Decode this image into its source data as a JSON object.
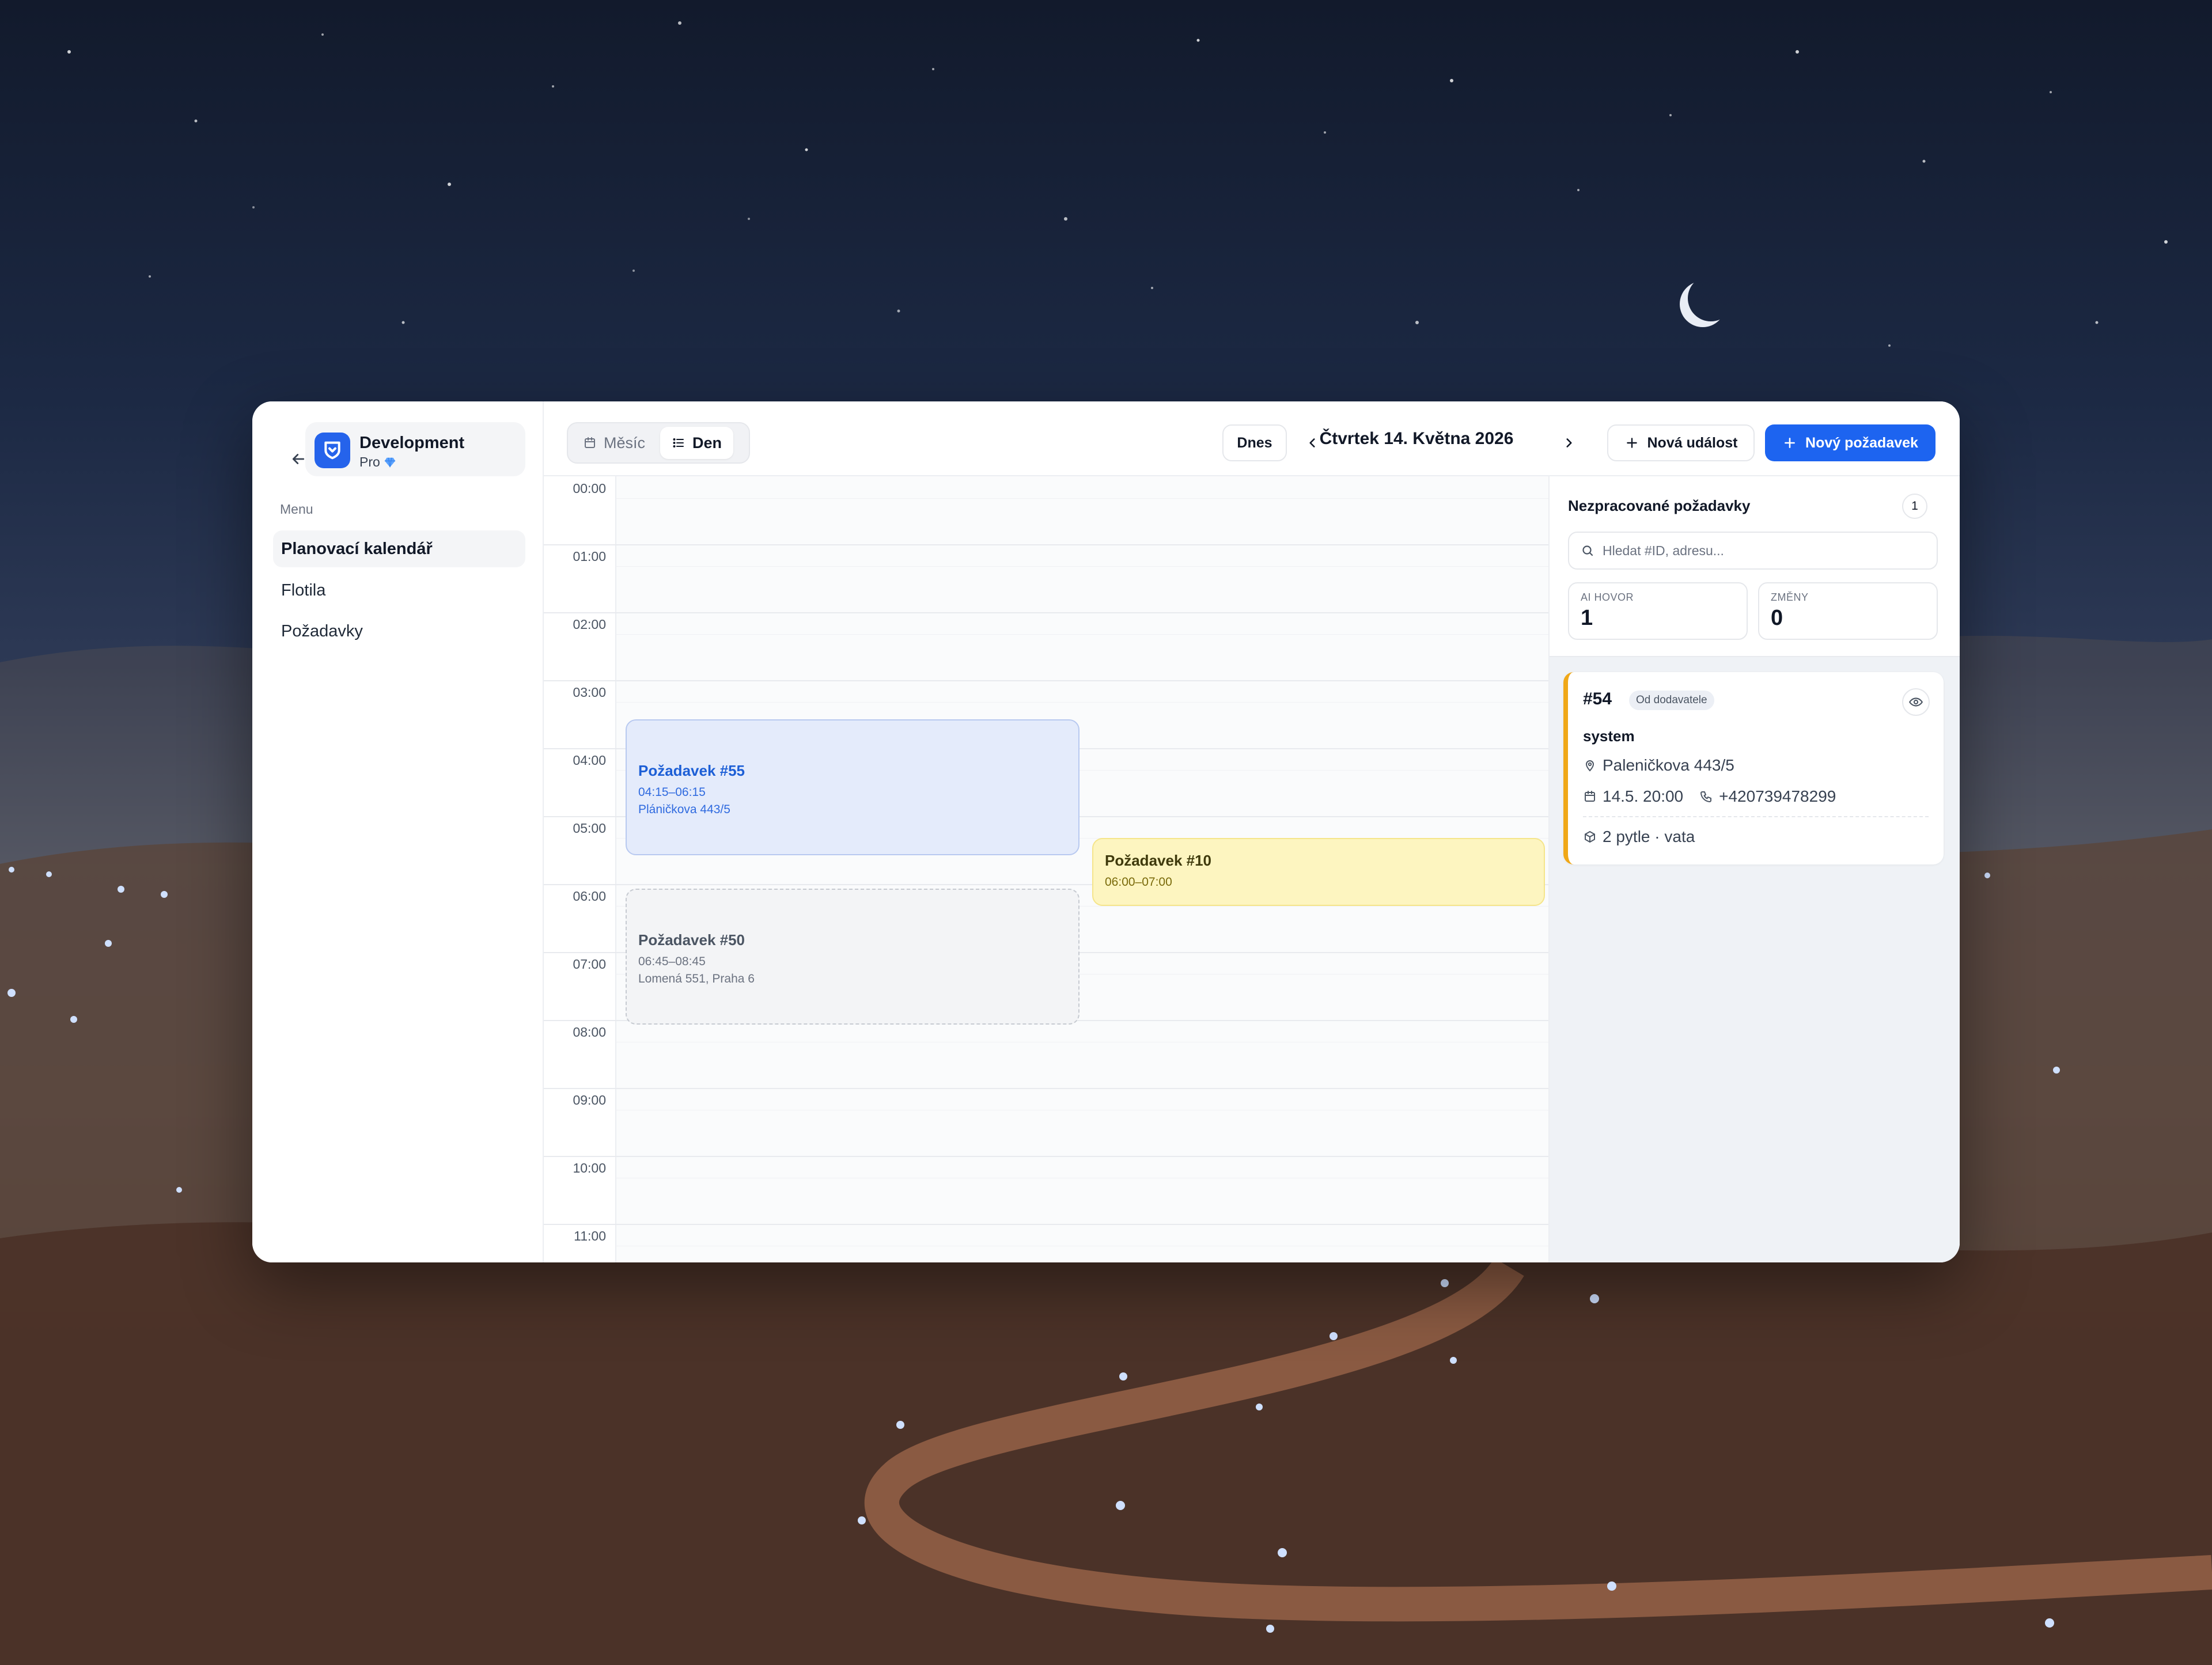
{
  "sidebar": {
    "org_name": "Development",
    "org_plan": "Pro",
    "menu_label": "Menu",
    "items": [
      {
        "label": "Planovací kalendář",
        "active": true
      },
      {
        "label": "Flotila",
        "active": false
      },
      {
        "label": "Požadavky",
        "active": false
      }
    ]
  },
  "toolbar": {
    "view_month": "Měsíc",
    "view_day": "Den",
    "active_view": "Den",
    "today_label": "Dnes",
    "date_title": "Čtvrtek 14. Května 2026",
    "new_event_label": "Nová událost",
    "new_request_label": "Nový požadavek"
  },
  "calendar": {
    "hours": [
      "00:00",
      "01:00",
      "02:00",
      "03:00",
      "04:00",
      "05:00",
      "06:00",
      "07:00",
      "08:00",
      "09:00",
      "10:00",
      "11:00"
    ],
    "events": [
      {
        "title": "Požadavek #55",
        "time": "04:15–06:15",
        "address": "Pláničkova 443/5",
        "style": "blue"
      },
      {
        "title": "Požadavek #10",
        "time": "06:00–07:00",
        "address": "",
        "style": "yellow"
      },
      {
        "title": "Požadavek #50",
        "time": "06:45–08:45",
        "address": "Lomená 551, Praha 6",
        "style": "dashed"
      }
    ]
  },
  "panel": {
    "title": "Nezpracované požadavky",
    "count": "1",
    "search_placeholder": "Hledat #ID, adresu...",
    "stats": [
      {
        "label": "AI HOVOR",
        "value": "1"
      },
      {
        "label": "ZMĚNY",
        "value": "0"
      }
    ],
    "card": {
      "id": "#54",
      "badge": "Od dodavatele",
      "name": "system",
      "address": "Paleničkova 443/5",
      "datetime": "14.5. 20:00",
      "phone": "+420739478299",
      "items": "2 pytle · vata"
    }
  },
  "colors": {
    "accent": "#1d64f0",
    "event_blue": "#e4ebfb",
    "event_yellow": "#fdf5c0",
    "card_border": "#f0a818"
  }
}
